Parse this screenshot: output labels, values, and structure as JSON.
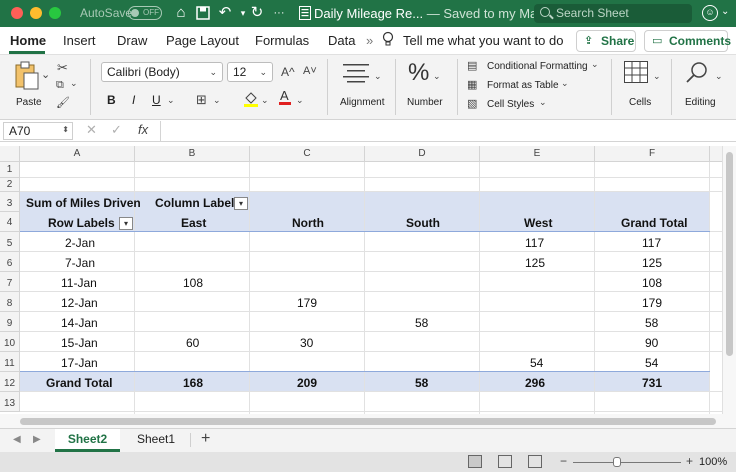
{
  "titlebar": {
    "autosave_label": "AutoSave",
    "autosave_state": "OFF",
    "document_title": "Daily Mileage Re...",
    "save_status": "— Saved to my Mac",
    "search_placeholder": "Search Sheet",
    "accent_color": "#217346"
  },
  "menu": {
    "tabs": [
      "Home",
      "Insert",
      "Draw",
      "Page Layout",
      "Formulas",
      "Data"
    ],
    "active_tab": "Home",
    "tell_me": "Tell me what you want to do",
    "share_label": "Share",
    "comments_label": "Comments"
  },
  "ribbon": {
    "paste_label": "Paste",
    "font_name": "Calibri (Body)",
    "font_size": "12",
    "grow_font": "A^",
    "shrink_font": "A˅",
    "bold": "B",
    "italic": "I",
    "underline": "U",
    "alignment_label": "Alignment",
    "number_label": "Number",
    "number_icon": "%",
    "conditional_formatting": "Conditional Formatting",
    "format_as_table": "Format as Table",
    "cell_styles": "Cell Styles",
    "cells_label": "Cells",
    "editing_label": "Editing"
  },
  "formula_bar": {
    "name_box": "A70",
    "fx": "fx",
    "value": ""
  },
  "columns": [
    "A",
    "B",
    "C",
    "D",
    "E",
    "F"
  ],
  "rows": [
    "1",
    "2",
    "3",
    "4",
    "5",
    "6",
    "7",
    "8",
    "9",
    "10",
    "11",
    "12",
    "13"
  ],
  "pivot": {
    "value_field": "Sum of Miles Driven",
    "column_labels": "Column Labels",
    "row_labels": "Row Labels",
    "headers": [
      "East",
      "North",
      "South",
      "West",
      "Grand Total"
    ],
    "rows": [
      {
        "label": "2-Jan",
        "east": "",
        "north": "",
        "south": "",
        "west": "117",
        "total": "117"
      },
      {
        "label": "7-Jan",
        "east": "",
        "north": "",
        "south": "",
        "west": "125",
        "total": "125"
      },
      {
        "label": "11-Jan",
        "east": "108",
        "north": "",
        "south": "",
        "west": "",
        "total": "108"
      },
      {
        "label": "12-Jan",
        "east": "",
        "north": "179",
        "south": "",
        "west": "",
        "total": "179"
      },
      {
        "label": "14-Jan",
        "east": "",
        "north": "",
        "south": "58",
        "west": "",
        "total": "58"
      },
      {
        "label": "15-Jan",
        "east": "60",
        "north": "30",
        "south": "",
        "west": "",
        "total": "90"
      },
      {
        "label": "17-Jan",
        "east": "",
        "north": "",
        "south": "",
        "west": "54",
        "total": "54"
      }
    ],
    "grand_total": {
      "label": "Grand Total",
      "east": "168",
      "north": "209",
      "south": "58",
      "west": "296",
      "total": "731"
    },
    "header_fill": "#d9e1f2"
  },
  "sheets": {
    "tabs": [
      "Sheet2",
      "Sheet1"
    ],
    "active": "Sheet2",
    "add": "+"
  },
  "status": {
    "zoom": "100%",
    "zoom_minus": "−",
    "zoom_plus": "+"
  }
}
